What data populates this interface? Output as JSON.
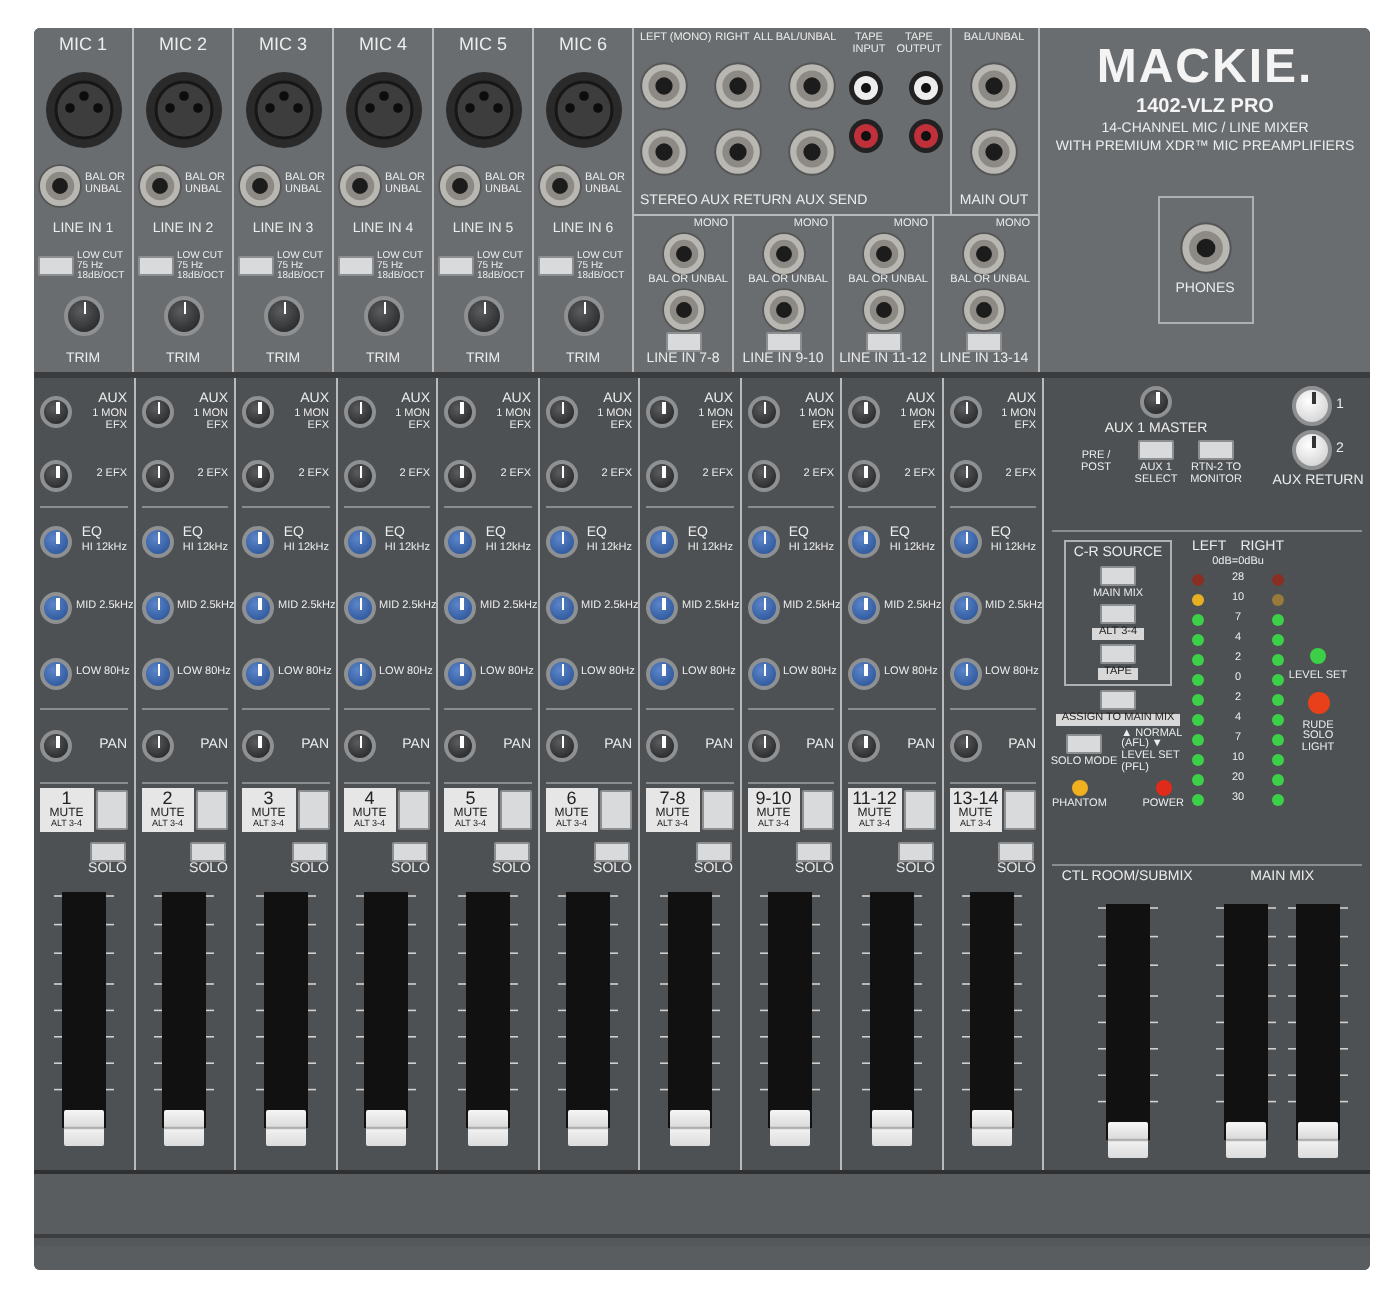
{
  "brand": {
    "logo": "MACKIE.",
    "model": "1402-VLZ PRO",
    "line_1": "14-CHANNEL MIC / LINE MIXER",
    "line_2": "WITH PREMIUM XDR™ MIC PREAMPLIFIERS"
  },
  "mic_strips": [
    {
      "mic": "MIC 1",
      "bal": "BAL OR UNBAL",
      "line": "LINE IN 1",
      "lowcut": "LOW CUT 75 Hz 18dB/OCT",
      "trim": "TRIM"
    },
    {
      "mic": "MIC 2",
      "bal": "BAL OR UNBAL",
      "line": "LINE IN 2",
      "lowcut": "LOW CUT 75 Hz 18dB/OCT",
      "trim": "TRIM"
    },
    {
      "mic": "MIC 3",
      "bal": "BAL OR UNBAL",
      "line": "LINE IN 3",
      "lowcut": "LOW CUT 75 Hz 18dB/OCT",
      "trim": "TRIM"
    },
    {
      "mic": "MIC 4",
      "bal": "BAL OR UNBAL",
      "line": "LINE IN 4",
      "lowcut": "LOW CUT 75 Hz 18dB/OCT",
      "trim": "TRIM"
    },
    {
      "mic": "MIC 5",
      "bal": "BAL OR UNBAL",
      "line": "LINE IN 5",
      "lowcut": "LOW CUT 75 Hz 18dB/OCT",
      "trim": "TRIM"
    },
    {
      "mic": "MIC 6",
      "bal": "BAL OR UNBAL",
      "line": "LINE IN 6",
      "lowcut": "LOW CUT 75 Hz 18dB/OCT",
      "trim": "TRIM"
    }
  ],
  "rear": {
    "left_mono": "LEFT (MONO)",
    "right": "RIGHT",
    "all_bal": "ALL BAL/UNBAL",
    "aux_return": "STEREO AUX RETURN",
    "aux_send": "AUX SEND",
    "tape_input": "TAPE INPUT",
    "tape_output": "TAPE OUTPUT",
    "main_bal": "BAL/UNBAL",
    "main_out": "MAIN OUT",
    "phones": "PHONES"
  },
  "stereo_strips": [
    {
      "mono": "MONO",
      "bal": "BAL OR UNBAL",
      "line": "LINE IN 7-8"
    },
    {
      "mono": "MONO",
      "bal": "BAL OR UNBAL",
      "line": "LINE IN 9-10"
    },
    {
      "mono": "MONO",
      "bal": "BAL OR UNBAL",
      "line": "LINE IN 11-12"
    },
    {
      "mono": "MONO",
      "bal": "BAL OR UNBAL",
      "line": "LINE IN 13-14"
    }
  ],
  "channels": [
    {
      "aux": "AUX",
      "aux1": "1 MON EFX",
      "aux2": "2 EFX",
      "eq": "EQ",
      "hi": "HI 12kHz",
      "mid": "MID 2.5kHz",
      "low": "LOW 80Hz",
      "pan": "PAN",
      "number": "1",
      "mute": "MUTE",
      "alt": "ALT 3-4",
      "solo": "SOLO",
      "level": 0
    },
    {
      "aux": "AUX",
      "aux1": "1 MON EFX",
      "aux2": "2 EFX",
      "eq": "EQ",
      "hi": "HI 12kHz",
      "mid": "MID 2.5kHz",
      "low": "LOW 80Hz",
      "pan": "PAN",
      "number": "2",
      "mute": "MUTE",
      "alt": "ALT 3-4",
      "solo": "SOLO",
      "level": 0
    },
    {
      "aux": "AUX",
      "aux1": "1 MON EFX",
      "aux2": "2 EFX",
      "eq": "EQ",
      "hi": "HI 12kHz",
      "mid": "MID 2.5kHz",
      "low": "LOW 80Hz",
      "pan": "PAN",
      "number": "3",
      "mute": "MUTE",
      "alt": "ALT 3-4",
      "solo": "SOLO",
      "level": 0
    },
    {
      "aux": "AUX",
      "aux1": "1 MON EFX",
      "aux2": "2 EFX",
      "eq": "EQ",
      "hi": "HI 12kHz",
      "mid": "MID 2.5kHz",
      "low": "LOW 80Hz",
      "pan": "PAN",
      "number": "4",
      "mute": "MUTE",
      "alt": "ALT 3-4",
      "solo": "SOLO",
      "level": 0
    },
    {
      "aux": "AUX",
      "aux1": "1 MON EFX",
      "aux2": "2 EFX",
      "eq": "EQ",
      "hi": "HI 12kHz",
      "mid": "MID 2.5kHz",
      "low": "LOW 80Hz",
      "pan": "PAN",
      "number": "5",
      "mute": "MUTE",
      "alt": "ALT 3-4",
      "solo": "SOLO",
      "level": 0
    },
    {
      "aux": "AUX",
      "aux1": "1 MON EFX",
      "aux2": "2 EFX",
      "eq": "EQ",
      "hi": "HI 12kHz",
      "mid": "MID 2.5kHz",
      "low": "LOW 80Hz",
      "pan": "PAN",
      "number": "6",
      "mute": "MUTE",
      "alt": "ALT 3-4",
      "solo": "SOLO",
      "level": 0
    },
    {
      "aux": "AUX",
      "aux1": "1 MON EFX",
      "aux2": "2 EFX",
      "eq": "EQ",
      "hi": "HI 12kHz",
      "mid": "MID 2.5kHz",
      "low": "LOW 80Hz",
      "pan": "PAN",
      "number": "7-8",
      "mute": "MUTE",
      "alt": "ALT 3-4",
      "solo": "SOLO",
      "level": 0
    },
    {
      "aux": "AUX",
      "aux1": "1 MON EFX",
      "aux2": "2 EFX",
      "eq": "EQ",
      "hi": "HI 12kHz",
      "mid": "MID 2.5kHz",
      "low": "LOW 80Hz",
      "pan": "PAN",
      "number": "9-10",
      "mute": "MUTE",
      "alt": "ALT 3-4",
      "solo": "SOLO",
      "level": 0
    },
    {
      "aux": "AUX",
      "aux1": "1 MON EFX",
      "aux2": "2 EFX",
      "eq": "EQ",
      "hi": "HI 12kHz",
      "mid": "MID 2.5kHz",
      "low": "LOW 80Hz",
      "pan": "PAN",
      "number": "11-12",
      "mute": "MUTE",
      "alt": "ALT 3-4",
      "solo": "SOLO",
      "level": 0
    },
    {
      "aux": "AUX",
      "aux1": "1 MON EFX",
      "aux2": "2 EFX",
      "eq": "EQ",
      "hi": "HI 12kHz",
      "mid": "MID 2.5kHz",
      "low": "LOW 80Hz",
      "pan": "PAN",
      "number": "13-14",
      "mute": "MUTE",
      "alt": "ALT 3-4",
      "solo": "SOLO",
      "level": 0
    }
  ],
  "master": {
    "aux1_master": "AUX 1 MASTER",
    "pre_post": "PRE / POST",
    "aux1_select": "AUX 1 SELECT",
    "rtn_monitor": "RTN-2 TO MONITOR",
    "return_1": "1",
    "return_2": "2",
    "aux_return": "AUX RETURN",
    "cr_source": "C-R SOURCE",
    "cr_main_mix": "MAIN MIX",
    "cr_alt": "ALT 3-4",
    "cr_tape": "TAPE",
    "assign": "ASSIGN TO MAIN MIX",
    "solo_mode": "SOLO MODE",
    "solo_mode_note": "▲ NORMAL (AFL) ▼ LEVEL SET (PFL)",
    "phantom": "PHANTOM",
    "power": "POWER",
    "left": "LEFT",
    "right": "RIGHT",
    "scale_note": "0dB=0dBu",
    "level_set": "LEVEL SET",
    "rude_solo": "RUDE SOLO LIGHT",
    "meter": [
      {
        "label": "28",
        "leds": [
          {
            "color": "#8a2e22"
          },
          {
            "color": "#8a2e22"
          }
        ]
      },
      {
        "label": "10",
        "leds": [
          {
            "color": "#e8b020"
          },
          {
            "color": "#9a7a3a"
          }
        ]
      },
      {
        "label": "7",
        "leds": [
          {
            "color": "#3ccf48"
          },
          {
            "color": "#3ccf48"
          }
        ]
      },
      {
        "label": "4",
        "leds": [
          {
            "color": "#3ccf48"
          },
          {
            "color": "#3ccf48"
          }
        ]
      },
      {
        "label": "2",
        "leds": [
          {
            "color": "#3ccf48"
          },
          {
            "color": "#3ccf48"
          }
        ]
      },
      {
        "label": "0",
        "leds": [
          {
            "color": "#3ccf48"
          },
          {
            "color": "#3ccf48"
          }
        ]
      },
      {
        "label": "2",
        "leds": [
          {
            "color": "#3ccf48"
          },
          {
            "color": "#3ccf48"
          }
        ]
      },
      {
        "label": "4",
        "leds": [
          {
            "color": "#3ccf48"
          },
          {
            "color": "#3ccf48"
          }
        ]
      },
      {
        "label": "7",
        "leds": [
          {
            "color": "#3ccf48"
          },
          {
            "color": "#3ccf48"
          }
        ]
      },
      {
        "label": "10",
        "leds": [
          {
            "color": "#3ccf48"
          },
          {
            "color": "#3ccf48"
          }
        ]
      },
      {
        "label": "20",
        "leds": [
          {
            "color": "#3ccf48"
          },
          {
            "color": "#3ccf48"
          }
        ]
      },
      {
        "label": "30",
        "leds": [
          {
            "color": "#3ccf48"
          },
          {
            "color": "#3ccf48"
          }
        ]
      }
    ],
    "ctl_room": "CTL ROOM/SUBMIX",
    "main_mix": "MAIN MIX",
    "ctl_fader": {
      "level": 0
    },
    "main_faders": [
      {
        "level": 0
      },
      {
        "level": 0
      }
    ]
  }
}
